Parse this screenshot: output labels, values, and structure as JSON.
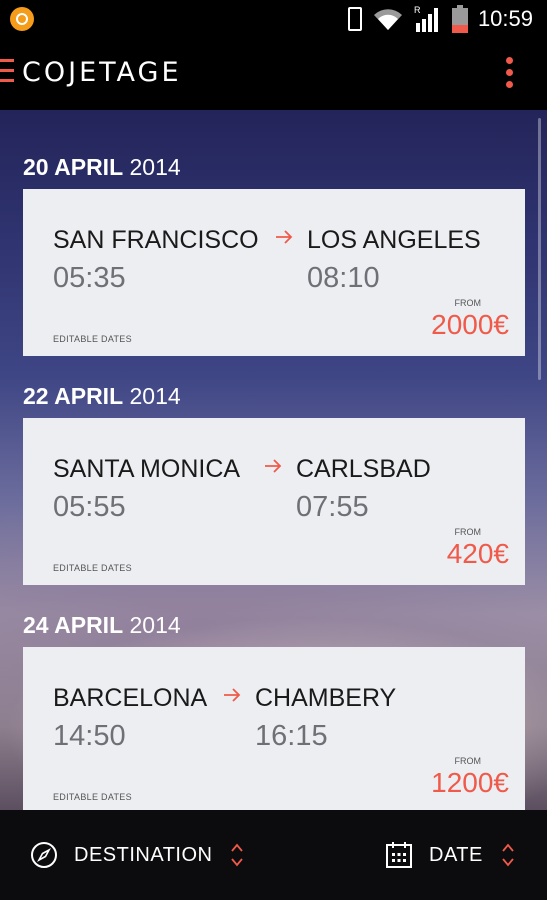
{
  "status_bar": {
    "time": "10:59",
    "signal_label": "R"
  },
  "app_bar": {
    "title": "COJETAGE"
  },
  "trips": [
    {
      "date_day": "20 APRIL",
      "date_year": "2014",
      "from_city": "SAN FRANCISCO",
      "to_city": "LOS ANGELES",
      "depart": "05:35",
      "arrive": "08:10",
      "editable_label": "EDITABLE DATES",
      "from_label": "FROM",
      "price": "2000€"
    },
    {
      "date_day": "22 APRIL",
      "date_year": "2014",
      "from_city": "SANTA MONICA",
      "to_city": "CARLSBAD",
      "depart": "05:55",
      "arrive": "07:55",
      "editable_label": "EDITABLE DATES",
      "from_label": "FROM",
      "price": "420€"
    },
    {
      "date_day": "24 APRIL",
      "date_year": "2014",
      "from_city": "BARCELONA",
      "to_city": "CHAMBERY",
      "depart": "14:50",
      "arrive": "16:15",
      "editable_label": "EDITABLE DATES",
      "from_label": "FROM",
      "price": "1200€"
    }
  ],
  "bottom_bar": {
    "destination_label": "DESTINATION",
    "date_label": "DATE"
  },
  "colors": {
    "accent": "#f05a4a",
    "card": "#eceef2",
    "bar": "#000000"
  },
  "icons": [
    "app-notification-icon",
    "phone-vibrate-icon",
    "wifi-icon",
    "signal-icon",
    "battery-icon",
    "hamburger-menu-icon",
    "overflow-menu-icon",
    "arrow-right-icon",
    "compass-icon",
    "calendar-icon",
    "sort-icon"
  ]
}
